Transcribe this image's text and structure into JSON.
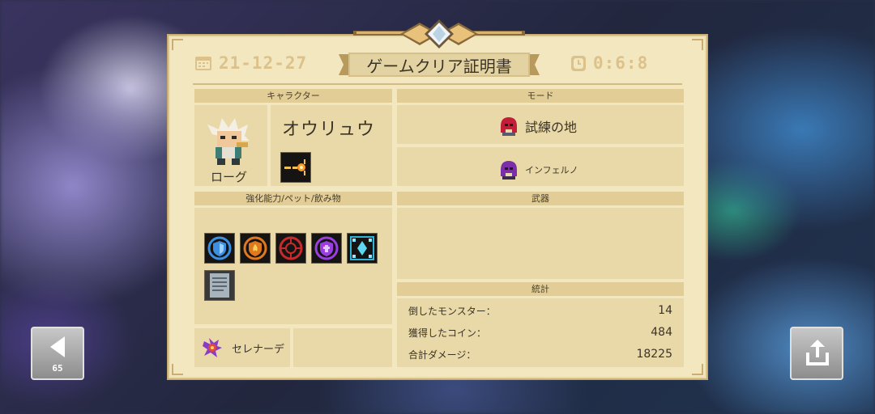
{
  "certificate": {
    "date": "21-12-27",
    "title": "ゲームクリア証明書",
    "time": "0:6:8"
  },
  "character": {
    "header": "キャラクター",
    "name": "オウリュウ",
    "class": "ローグ",
    "icon": "rogue-portrait-icon",
    "skill_icon": "dash-skill-icon"
  },
  "mode": {
    "header": "モード",
    "stage": "試練の地",
    "difficulty": "インフェルノ"
  },
  "buffs": {
    "header": "強化能力/ペット/飲み物",
    "items": [
      "blue-shield-icon",
      "fire-shield-icon",
      "crosshair-icon",
      "purple-shield-icon",
      "ice-crystal-icon",
      "scroll-icon"
    ],
    "pet": "セレナーデ"
  },
  "weapons": {
    "header": "武器"
  },
  "stats": {
    "header": "統計",
    "rows": [
      {
        "label": "倒したモンスター：",
        "value": "14"
      },
      {
        "label": "獲得したコイン：",
        "value": "484"
      },
      {
        "label": "合計ダメージ：",
        "value": "18225"
      }
    ]
  },
  "nav": {
    "back_count": "65"
  },
  "colors": {
    "parchment": "#f3e7c0",
    "header_bar": "#e1cd95",
    "gold": "#dcc28a"
  }
}
